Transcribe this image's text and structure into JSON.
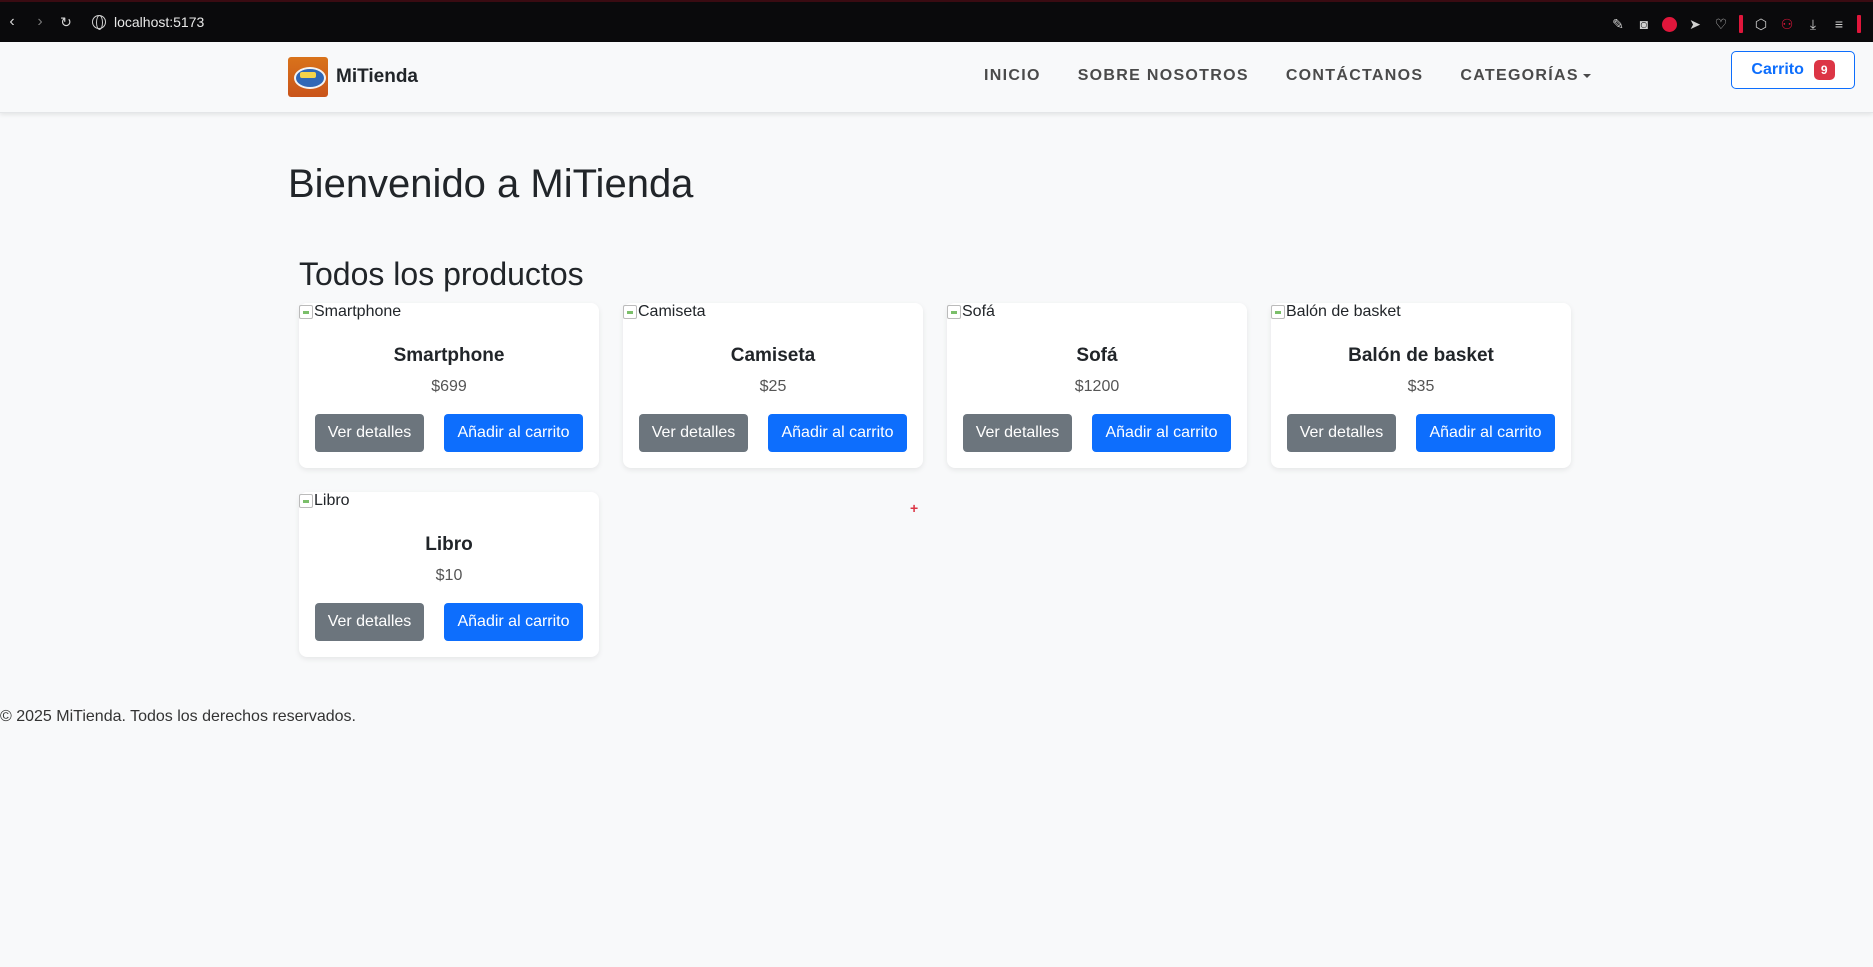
{
  "browser": {
    "url": "localhost:5173"
  },
  "navbar": {
    "brand": "MiTienda",
    "links": [
      "INICIO",
      "SOBRE NOSOTROS",
      "CONTÁCTANOS",
      "CATEGORÍAS"
    ],
    "cart_label": "Carrito",
    "cart_count": "9"
  },
  "main": {
    "title": "Bienvenido a MiTienda",
    "section_title": "Todos los productos",
    "products": [
      {
        "alt": "Smartphone",
        "name": "Smartphone",
        "price": "$699"
      },
      {
        "alt": "Camiseta",
        "name": "Camiseta",
        "price": "$25"
      },
      {
        "alt": "Sofá",
        "name": "Sofá",
        "price": "$1200"
      },
      {
        "alt": "Balón de basket",
        "name": "Balón de basket",
        "price": "$35"
      },
      {
        "alt": "Libro",
        "name": "Libro",
        "price": "$10"
      }
    ],
    "details_label": "Ver detalles",
    "add_label": "Añadir al carrito"
  },
  "footer": {
    "text": "© 2025 MiTienda. Todos los derechos reservados."
  },
  "colors": {
    "primary": "#0d6efd",
    "secondary": "#6c757d",
    "danger": "#dc3545",
    "background": "#f8f9fa"
  }
}
